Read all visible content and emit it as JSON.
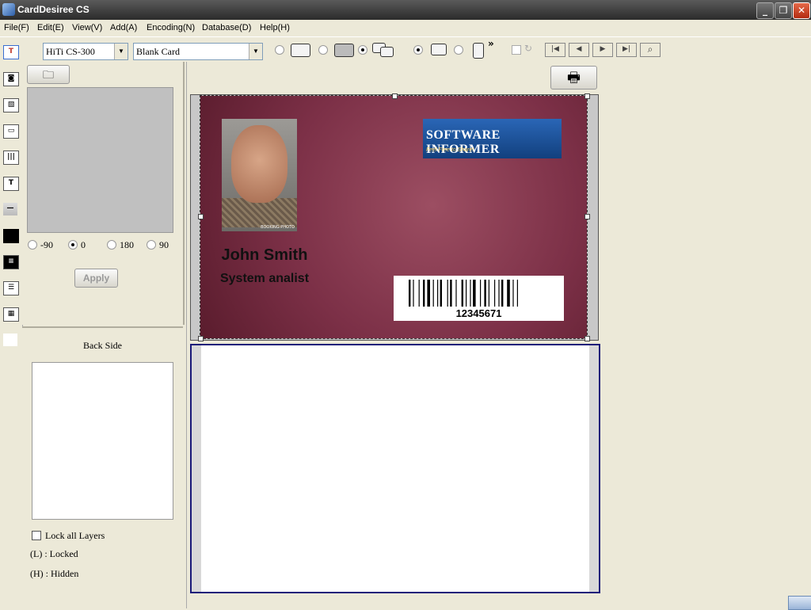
{
  "window": {
    "title": "CardDesiree CS",
    "minimize": "_",
    "restore": "❐",
    "close": "✕"
  },
  "menu": [
    "File(F)",
    "Edit(E)",
    "View(V)",
    "Add(A)",
    "Encoding(N)",
    "Database(D)",
    "Help(H)"
  ],
  "toolbar": {
    "printer": "HiTi CS-300",
    "card_type": "Blank Card",
    "overflow": "»",
    "nav": [
      "|◀",
      "◀",
      "▶",
      "▶|"
    ]
  },
  "image_panel": {
    "rotation_options": [
      "-90",
      "0",
      "180",
      "90"
    ],
    "rotation_selected": "0",
    "apply_label": "Apply"
  },
  "layer_panel": {
    "back_side_label": "Back Side",
    "lock_all_label": "Lock all Layers",
    "locked_legend": "(L) : Locked",
    "hidden_legend": "(H) : Hidden"
  },
  "card": {
    "name": "John Smith",
    "job_title": "System analist",
    "logo_title": "Software Informer",
    "logo_title_display": "SOFTWARE INFORMER",
    "logo_slogan": "Feel Free to Share!",
    "barcode_number": "12345671",
    "photo_caption": "BOOKING PHOTO"
  },
  "colors": {
    "card_accent": "#7c3047",
    "logo_blue": "#1f56a0",
    "back_frame": "#1a1a7a"
  }
}
